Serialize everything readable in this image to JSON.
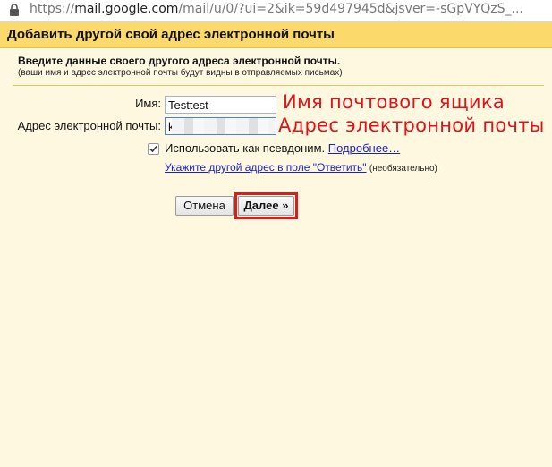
{
  "browser": {
    "url_scheme": "https://",
    "url_host": "mail.google.com",
    "url_rest": "/mail/u/0/?ui=2&ik=59d497945d&jsver=-sGpVYQzS_..."
  },
  "dialog": {
    "title": "Добавить другой свой адрес электронной почты",
    "intro_main": "Введите данные своего другого адреса электронной почты.",
    "intro_sub": "(ваши имя и адрес электронной почты будут видны в отправляемых письмах)",
    "name_label": "Имя:",
    "name_value": "Testtest",
    "email_label": "Адрес электронной почты:",
    "email_value": "k",
    "alias_checked": true,
    "alias_label": "Использовать как псевдоним.",
    "alias_more_link": "Подробнее…",
    "reply_link": "Укажите другой адрес в поле \"Ответить\"",
    "reply_optional": "(необязательно)",
    "cancel_label": "Отмена",
    "next_label": "Далее »"
  },
  "annotations": {
    "name_note": "Имя почтового ящика",
    "email_note": "Адрес электронной почты",
    "color": "#e0121a"
  }
}
